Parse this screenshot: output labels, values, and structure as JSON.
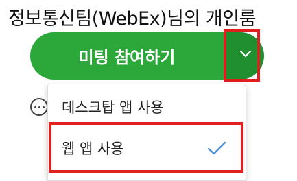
{
  "header": {
    "title": "정보통신팀(WebEx)님의 개인룸"
  },
  "join": {
    "label": "미팅 참여하기",
    "dropdown_icon": "chevron-down-icon",
    "primary_color": "#2ca83b",
    "dropdown_color": "#1f8f2f"
  },
  "more": {
    "icon": "more-options-icon"
  },
  "menu": {
    "items": [
      {
        "label": "데스크탑 앱 사용",
        "selected": false
      },
      {
        "label": "웹 앱 사용",
        "selected": true,
        "check_icon": "checkmark-icon",
        "check_color": "#4d8fd6"
      }
    ]
  },
  "annotations": {
    "highlight_color": "#e01f1f"
  }
}
